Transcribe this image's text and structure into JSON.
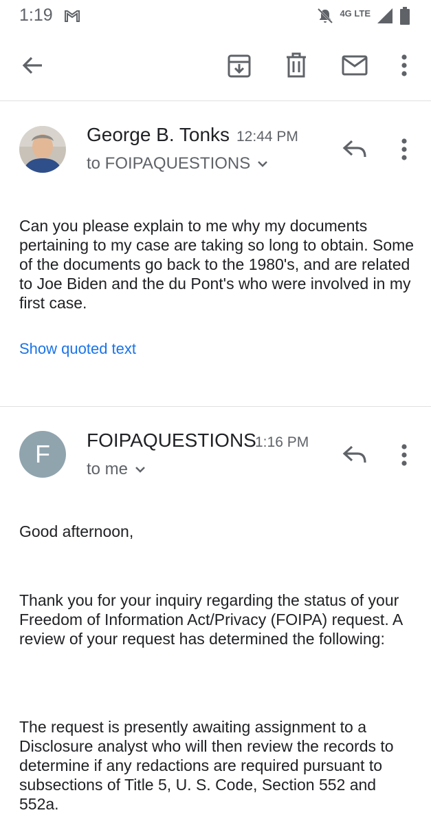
{
  "status_bar": {
    "time": "1:19",
    "network": "4G LTE"
  },
  "toolbar": {
    "back": "back-arrow-icon",
    "archive": "archive-icon",
    "delete": "trash-icon",
    "mark_unread": "mail-icon",
    "more": "more-vert-icon"
  },
  "messages": [
    {
      "sender": "George B. Tonks",
      "time": "12:44 PM",
      "recipient": "to FOIPAQUESTIONS",
      "body": "Can you please explain to me why my documents pertaining to my case are taking so long to obtain. Some of the documents go back to the 1980's, and are related to Joe Biden and the du Pont's who were involved in my first case.",
      "show_quoted": "Show quoted text"
    },
    {
      "sender": "FOIPAQUESTIONS",
      "time": "1:16 PM",
      "recipient": "to me",
      "avatar_letter": "F",
      "avatar_color": "#90a4ae",
      "body_paragraphs": [
        "Good afternoon,",
        "Thank you for your inquiry regarding the status of your Freedom of Information Act/Privacy (FOIPA) request.   A review of your request has determined the following:",
        "The request is presently awaiting assignment to a Disclosure analyst who will then review the records to determine if any redactions are required pursuant to subsections of Title 5, U. S. Code, Section 552 and 552a."
      ]
    }
  ],
  "colors": {
    "link": "#1a73e8",
    "icon_gray": "#5f6368",
    "divider": "#e0e0e0"
  }
}
